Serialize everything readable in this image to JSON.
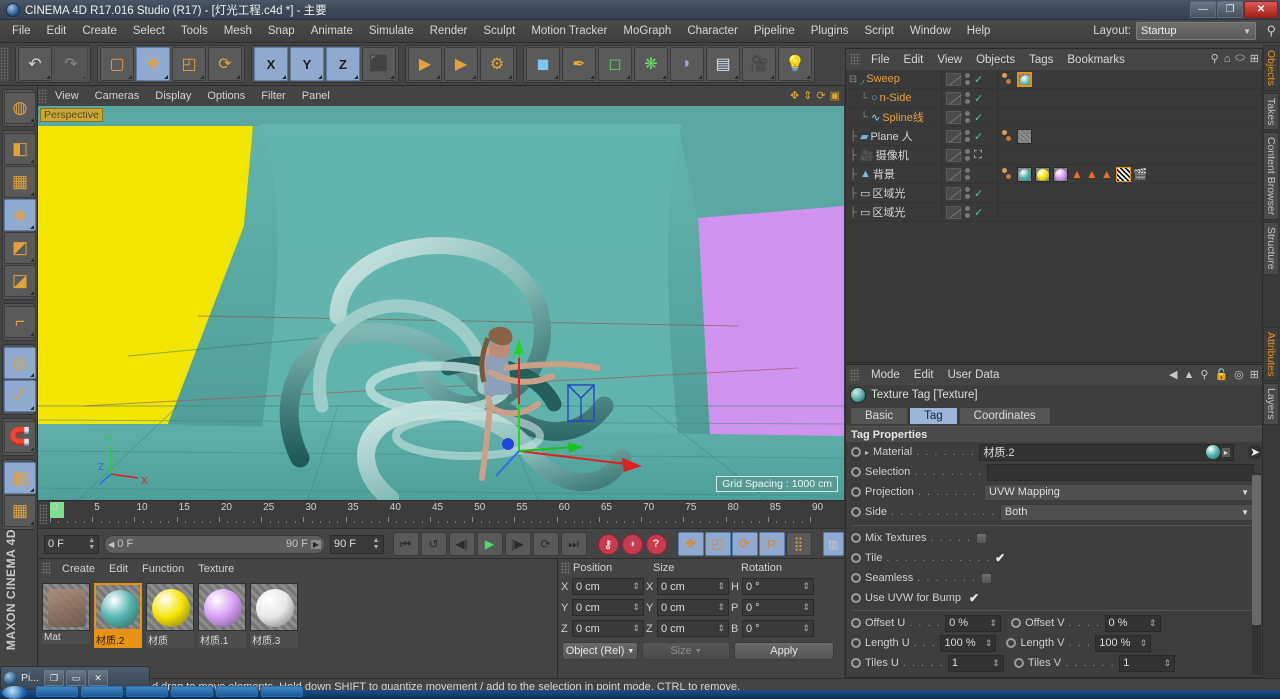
{
  "window": {
    "title": "CINEMA 4D R17.016 Studio (R17) - [灯光工程.c4d *] - 主要",
    "minimize": "—",
    "maximize": "❐",
    "close": "✕"
  },
  "menubar": {
    "items": [
      "File",
      "Edit",
      "Create",
      "Select",
      "Tools",
      "Mesh",
      "Snap",
      "Animate",
      "Simulate",
      "Render",
      "Sculpt",
      "Motion Tracker",
      "MoGraph",
      "Character",
      "Pipeline",
      "Plugins",
      "Script",
      "Window",
      "Help"
    ],
    "layout_label": "Layout:",
    "layout_value": "Startup"
  },
  "toolbar": {
    "groups": [
      {
        "name": "undo-redo",
        "buttons": [
          {
            "name": "undo-button",
            "glyph": "↶"
          },
          {
            "name": "redo-button",
            "glyph": "↷"
          }
        ]
      },
      {
        "name": "tools",
        "buttons": [
          {
            "name": "selection-tool",
            "glyph": "▢"
          },
          {
            "name": "move-tool",
            "glyph": "✥"
          },
          {
            "name": "scale-tool",
            "glyph": "◰"
          },
          {
            "name": "rotate-tool",
            "glyph": "⟳"
          }
        ]
      },
      {
        "name": "axis-lock",
        "buttons": [
          {
            "name": "lock-x-button",
            "glyph": "X"
          },
          {
            "name": "lock-y-button",
            "glyph": "Y"
          },
          {
            "name": "lock-z-button",
            "glyph": "Z"
          },
          {
            "name": "world-object-coord-button",
            "glyph": "⬛"
          }
        ]
      },
      {
        "name": "render",
        "buttons": [
          {
            "name": "render-view-button",
            "glyph": "▶"
          },
          {
            "name": "render-to-picture-viewer-button",
            "glyph": "▶"
          },
          {
            "name": "render-settings-button",
            "glyph": "⚙"
          }
        ]
      },
      {
        "name": "objects",
        "buttons": [
          {
            "name": "add-cube-button",
            "glyph": "◼"
          },
          {
            "name": "add-spline-button",
            "glyph": "✒"
          },
          {
            "name": "add-generator-button",
            "glyph": "◻"
          },
          {
            "name": "add-array-button",
            "glyph": "❋"
          },
          {
            "name": "add-bend-deformer-button",
            "glyph": "◗"
          },
          {
            "name": "add-floor-button",
            "glyph": "▤"
          },
          {
            "name": "add-camera-button",
            "glyph": "🎥"
          },
          {
            "name": "add-light-button",
            "glyph": "💡"
          }
        ]
      }
    ]
  },
  "lefttoolbar": {
    "buttons": [
      {
        "name": "make-editable-button",
        "glyph": "◍"
      },
      {
        "name": "model-mode-button",
        "glyph": "◧"
      },
      {
        "name": "texture-mode-button",
        "glyph": "▦"
      },
      {
        "name": "points-mode-button",
        "glyph": "◈"
      },
      {
        "name": "edges-mode-button",
        "glyph": "◩"
      },
      {
        "name": "polygons-mode-button",
        "glyph": "◪"
      },
      {
        "name": "axis-modify-button",
        "glyph": "⌐"
      },
      {
        "name": "viewport-solo-button",
        "glyph": "◎"
      },
      {
        "name": "enable-axis-button",
        "glyph": "⤤"
      },
      {
        "name": "snap-magnet-button",
        "glyph": "🧲"
      },
      {
        "name": "workplane-lock-button",
        "glyph": "▦"
      },
      {
        "name": "workplane-rotate-button",
        "glyph": "▦"
      }
    ],
    "brand": "MAXON CINEMA 4D"
  },
  "viewport": {
    "menu": [
      "View",
      "Cameras",
      "Display",
      "Options",
      "Filter",
      "Panel"
    ],
    "label": "Perspective",
    "grid_spacing": "Grid Spacing : 1000 cm",
    "axis_labels": {
      "x": "X",
      "y": "Y",
      "z": "Z"
    }
  },
  "timeline": {
    "ticks": [
      0,
      5,
      10,
      15,
      20,
      25,
      30,
      35,
      40,
      45,
      50,
      55,
      60,
      65,
      70,
      75,
      80,
      85,
      90
    ],
    "current_frame_left": "0 F",
    "range_start": "0 F",
    "range_end": "90 F",
    "end_frame": "90 F",
    "current_frame_right": "0 F",
    "transport": [
      {
        "name": "go-to-start-button",
        "glyph": "⏮"
      },
      {
        "name": "play-backwards-loop-button",
        "glyph": "↺"
      },
      {
        "name": "step-back-button",
        "glyph": "◀|"
      },
      {
        "name": "play-button",
        "glyph": "▶"
      },
      {
        "name": "step-forward-button",
        "glyph": "|▶"
      },
      {
        "name": "loop-button",
        "glyph": "⟳"
      },
      {
        "name": "go-to-end-button",
        "glyph": "⏭"
      }
    ],
    "keys": [
      {
        "name": "record-active-objects-button",
        "glyph": "🔑"
      },
      {
        "name": "autokeying-button",
        "glyph": "◑"
      },
      {
        "name": "keyframe-selection-button",
        "glyph": "?"
      }
    ],
    "record_toggles": [
      {
        "name": "record-position-button",
        "glyph": "✥"
      },
      {
        "name": "record-scale-button",
        "glyph": "◰"
      },
      {
        "name": "record-rotation-button",
        "glyph": "⟳"
      },
      {
        "name": "record-parameter-button",
        "glyph": "P"
      },
      {
        "name": "record-pla-button",
        "glyph": "⣿"
      }
    ],
    "timeline_button": {
      "name": "timeline-button",
      "glyph": "▥"
    }
  },
  "materials": {
    "menu": [
      "Create",
      "Edit",
      "Function",
      "Texture"
    ],
    "items": [
      {
        "name": "Mat",
        "color": "#b08f7a",
        "selected": false,
        "kind": "preview"
      },
      {
        "name": "材质.2",
        "color": "#4fb3ac",
        "selected": true,
        "kind": "ball"
      },
      {
        "name": "材质",
        "color": "#f5e400",
        "selected": false,
        "kind": "ball"
      },
      {
        "name": "材质.1",
        "color": "#d79cf5",
        "selected": false,
        "kind": "ball"
      },
      {
        "name": "材质.3",
        "color": "#e8e8e8",
        "selected": false,
        "kind": "ball"
      }
    ]
  },
  "coordinates": {
    "headers": [
      "Position",
      "Size",
      "Rotation"
    ],
    "rows": [
      {
        "pos_label": "X",
        "pos": "0 cm",
        "size_label": "X",
        "size": "0 cm",
        "rot_label": "H",
        "rot": "0 °"
      },
      {
        "pos_label": "Y",
        "pos": "0 cm",
        "size_label": "Y",
        "size": "0 cm",
        "rot_label": "P",
        "rot": "0 °"
      },
      {
        "pos_label": "Z",
        "pos": "0 cm",
        "size_label": "Z",
        "size": "0 cm",
        "rot_label": "B",
        "rot": "0 °"
      }
    ],
    "mode_dropdown": "Object (Rel)",
    "size_dropdown": "Size",
    "apply_button": "Apply"
  },
  "objectmanager": {
    "menu": [
      "File",
      "Edit",
      "View",
      "Objects",
      "Tags",
      "Bookmarks"
    ],
    "icons": [
      {
        "name": "search-icon",
        "glyph": "⚲"
      },
      {
        "name": "home-icon",
        "glyph": "⌂"
      },
      {
        "name": "ellipse-icon",
        "glyph": "⬭"
      },
      {
        "name": "new-layer-icon",
        "glyph": "⊞"
      }
    ],
    "rows": [
      {
        "label": "Sweep",
        "indent": 0,
        "color": "#e2a33c",
        "icon": "sweep-icon",
        "vis": true,
        "expander": "⊟",
        "tags": [
          {
            "type": "ball",
            "color": "#4fb3ac",
            "selected": true
          }
        ],
        "has_extra_dots": true
      },
      {
        "label": "n-Side",
        "indent": 1,
        "color": "#e2a33c",
        "icon": "nside-icon",
        "vis": true,
        "tags": []
      },
      {
        "label": "Spline线",
        "indent": 1,
        "color": "#e2a33c",
        "icon": "spline-icon",
        "vis": true,
        "tags": []
      },
      {
        "label": "Plane 人",
        "indent": 0,
        "color": "#d6d6d6",
        "icon": "plane-icon",
        "vis": true,
        "tags": [
          {
            "type": "checker"
          }
        ],
        "has_extra_dots": true
      },
      {
        "label": "摄像机",
        "indent": 0,
        "color": "#d6d6d6",
        "icon": "camera-icon",
        "vis": false,
        "tags": []
      },
      {
        "label": "背景",
        "indent": 0,
        "color": "#d6d6d6",
        "icon": "background-icon",
        "vis": false,
        "tags": [
          {
            "type": "ball",
            "color": "#4fb3ac"
          },
          {
            "type": "ball",
            "color": "#f5e400"
          },
          {
            "type": "ball",
            "color": "#d79cf5"
          },
          {
            "type": "tri"
          },
          {
            "type": "tri"
          },
          {
            "type": "tri"
          },
          {
            "type": "checker2"
          },
          {
            "type": "film"
          }
        ],
        "has_extra_dots": true
      },
      {
        "label": "区域光",
        "indent": 0,
        "color": "#d6d6d6",
        "icon": "arealight-icon",
        "vis": true,
        "tags": []
      },
      {
        "label": "区域光",
        "indent": 0,
        "color": "#d6d6d6",
        "icon": "arealight-icon",
        "vis": true,
        "tags": []
      }
    ]
  },
  "attributes": {
    "menu": [
      "Mode",
      "Edit",
      "User Data"
    ],
    "icons": [
      {
        "name": "back-arrow-icon",
        "glyph": "◀"
      },
      {
        "name": "up-arrow-icon",
        "glyph": "▲"
      },
      {
        "name": "search-icon",
        "glyph": "⚲"
      },
      {
        "name": "lock-icon",
        "glyph": "🔓"
      },
      {
        "name": "target-icon",
        "glyph": "◎"
      },
      {
        "name": "new-icon",
        "glyph": "⊞"
      }
    ],
    "object_title": "Texture Tag [Texture]",
    "tabs": [
      {
        "label": "Basic",
        "selected": false
      },
      {
        "label": "Tag",
        "selected": true
      },
      {
        "label": "Coordinates",
        "selected": false
      }
    ],
    "section_title": "Tag Properties",
    "fields": [
      {
        "label": "Material",
        "dots": ". . . . . . .",
        "value": "材质.2",
        "type": "material"
      },
      {
        "label": "Selection",
        "dots": ". . . . . . . .",
        "value": "",
        "type": "text"
      },
      {
        "label": "Projection",
        "dots": ". . . . . . .",
        "value": "UVW Mapping",
        "type": "dropdown"
      },
      {
        "label": "Side",
        "dots": ". . . . . . . . . . . .",
        "value": "Both",
        "type": "dropdown"
      }
    ],
    "checkboxes": [
      {
        "label": "Mix Textures",
        "dots": ". . . . .",
        "checked": false
      },
      {
        "label": "Tile",
        "dots": ". . . . . . . . . . . .",
        "checked": true
      },
      {
        "label": "Seamless",
        "dots": ". . . . . . .",
        "checked": false
      },
      {
        "label": "Use UVW for Bump",
        "dots": "",
        "checked": true
      }
    ],
    "uvgrid": [
      {
        "l1": "Offset U",
        "d1": ". . . .",
        "v1": "0 %",
        "l2": "Offset V",
        "d2": ". . . .",
        "v2": "0 %"
      },
      {
        "l1": "Length U",
        "d1": ". . .",
        "v1": "100 %",
        "l2": "Length V",
        "d2": ". . .",
        "v2": "100 %"
      },
      {
        "l1": "Tiles U",
        "d1": ". . . . .",
        "v1": "1",
        "l2": "Tiles V",
        "d2": ". . . . . .",
        "v2": "1"
      }
    ]
  },
  "vtabs_top": [
    {
      "label": "Objects",
      "selected": true
    },
    {
      "label": "Takes",
      "selected": false
    },
    {
      "label": "Content Browser",
      "selected": false
    },
    {
      "label": "Structure",
      "selected": false
    }
  ],
  "vtabs_bottom": [
    {
      "label": "Attributes",
      "selected": true
    },
    {
      "label": "Layers",
      "selected": false
    }
  ],
  "statusbar": {
    "text": "d drag to move elements. Hold down SHIFT to quantize movement / add to the selection in point mode, CTRL to remove."
  },
  "taskbar": {
    "popup_title": "Pi...",
    "popup_buttons": [
      "❐",
      "▭",
      "✕"
    ]
  },
  "colors": {
    "accent_orange": "#e69313",
    "tab_blue": "#9db4da",
    "viewport_teal": "#54a49d",
    "wall_yellow": "#f2e500",
    "wall_magenta": "#d79cf5"
  }
}
